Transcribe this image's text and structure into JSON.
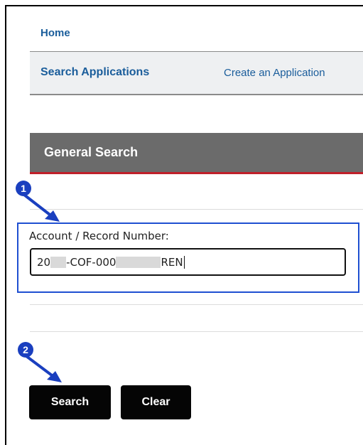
{
  "nav": {
    "home_label": "Home",
    "search_applications_label": "Search Applications",
    "create_application_label": "Create an Application"
  },
  "section": {
    "title": "General Search"
  },
  "form": {
    "record_label": "Account / Record Number:",
    "record_value_parts": [
      "20",
      "-COF-000",
      "REN"
    ]
  },
  "callouts": {
    "step1": "1",
    "step2": "2"
  },
  "actions": {
    "search_label": "Search",
    "clear_label": "Clear"
  },
  "colors": {
    "link": "#1a5d9b",
    "header_bg": "#6b6b6b",
    "header_underline": "#c0202a",
    "callout": "#1a3fbf",
    "button_bg": "#050505"
  }
}
